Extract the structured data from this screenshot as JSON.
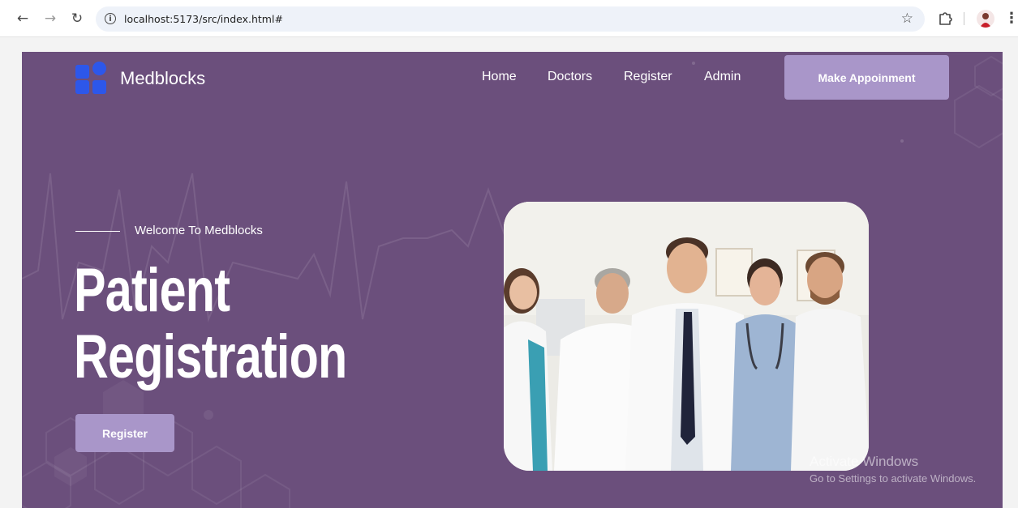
{
  "browser": {
    "url": "localhost:5173/src/index.html#",
    "back_icon": "←",
    "forward_icon": "→",
    "reload_icon": "↻",
    "info_icon": "i",
    "star_icon": "☆",
    "menu_icon": "⋮"
  },
  "header": {
    "brand": "Medblocks",
    "nav": [
      "Home",
      "Doctors",
      "Register",
      "Admin"
    ],
    "cta_label": "Make Appoinment"
  },
  "hero": {
    "eyebrow": "Welcome To Medblocks",
    "headline_line1": "Patient",
    "headline_line2": "Registration",
    "button_label": "Register"
  },
  "watermark": {
    "title": "Activate Windows",
    "subtitle": "Go to Settings to activate Windows."
  },
  "colors": {
    "hero_bg": "#6b4f7c",
    "button_bg": "#a996c9",
    "logo_blue": "#2d57ea"
  }
}
